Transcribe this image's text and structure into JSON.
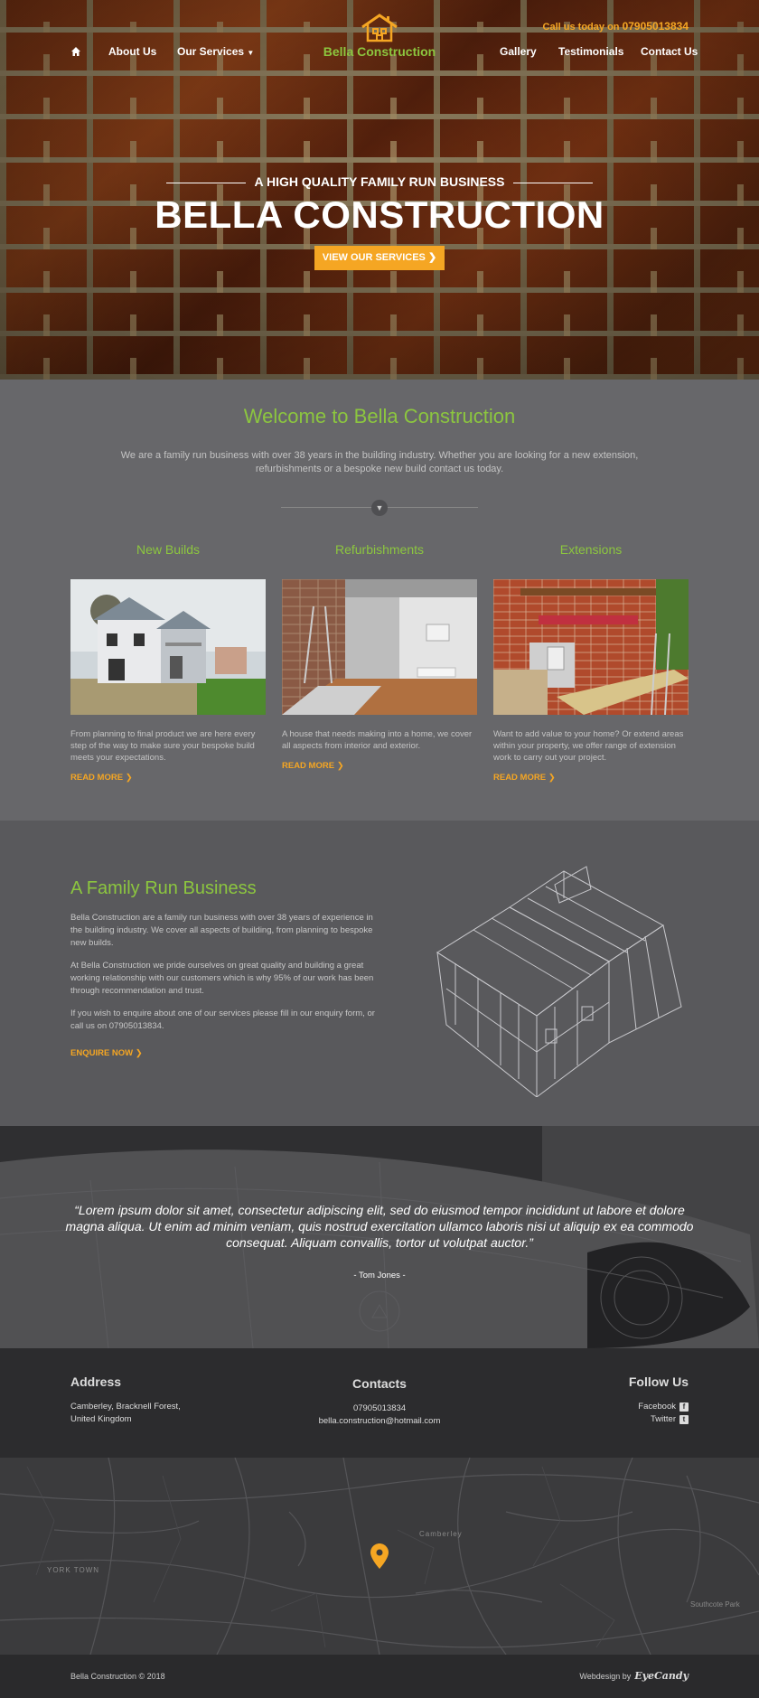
{
  "topbar": {
    "call_label": "Call us today on",
    "phone": "07905013834"
  },
  "nav": {
    "about": "About Us",
    "services": "Our Services",
    "brand": "Bella Construction",
    "gallery": "Gallery",
    "testimonials": "Testimonials",
    "contact": "Contact Us"
  },
  "hero": {
    "kicker": "A HIGH QUALITY FAMILY RUN BUSINESS",
    "title": "BELLA CONSTRUCTION",
    "button": "VIEW OUR SERVICES"
  },
  "welcome": {
    "title": "Welcome to Bella Construction",
    "intro": "We are a family run business with over 38 years in the building industry. Whether you are looking for a new extension, refurbishments or a bespoke new build contact us today."
  },
  "services": [
    {
      "title": "New Builds",
      "text": "From planning to final product we are here every step of the way to make sure your bespoke build meets your expectations.",
      "more": "READ MORE"
    },
    {
      "title": "Refurbishments",
      "text": "A house that needs making into a home, we cover all aspects from interior and exterior.",
      "more": "READ MORE"
    },
    {
      "title": "Extensions",
      "text": "Want to add value to your home? Or extend areas within your property, we offer range of extension work to carry out your project.",
      "more": "READ MORE"
    }
  ],
  "family": {
    "title": "A Family Run Business",
    "p1": "Bella Construction are a family run business with over 38 years of experience in the building industry. We cover all aspects of building, from planning to bespoke new builds.",
    "p2": "At Bella Construction we pride ourselves on great quality and building a great working relationship with our customers which is why 95% of our work has been through recommendation and trust.",
    "p3": "If you wish to enquire about one of our services please fill in our enquiry form, or call us on 07905013834.",
    "more": "ENQUIRE NOW"
  },
  "testimonial": {
    "quote": "“Lorem ipsum dolor sit amet, consectetur adipiscing elit, sed do eiusmod tempor incididunt ut labore et dolore magna aliqua. Ut enim ad minim veniam, quis nostrud exercitation ullamco laboris nisi ut aliquip ex ea commodo consequat. Aliquam convallis, tortor ut volutpat auctor.”",
    "author": "- Tom Jones -"
  },
  "footer": {
    "address_title": "Address",
    "address_line1": "Camberley, Bracknell Forest,",
    "address_line2": "United Kingdom",
    "contacts_title": "Contacts",
    "phone": "07905013834",
    "email": "bella.construction@hotmail.com",
    "follow_title": "Follow Us",
    "facebook": "Facebook",
    "twitter": "Twitter"
  },
  "map": {
    "label_town": "Camberley",
    "label_york": "YORK TOWN",
    "label_park": "Southcote Park"
  },
  "bottom": {
    "copyright": "Bella Construction © 2018",
    "webdesign": "Webdesign by",
    "designer": "EyeCandy"
  },
  "colors": {
    "green": "#8cc63f",
    "orange": "#f5a623"
  }
}
